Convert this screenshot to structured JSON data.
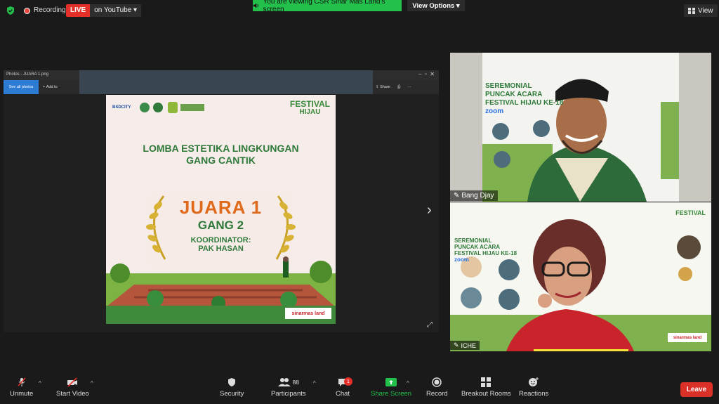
{
  "topbar": {
    "recording": "Recording",
    "live": "LIVE",
    "on_youtube": "on YouTube",
    "share_banner": "You are viewing CSR Sinar Mas Land's screen",
    "view_options": "View Options",
    "view": "View"
  },
  "photos_app": {
    "title": "Photos - JUARA 1.png",
    "see_all": "See all photos",
    "add_to": "Add to",
    "share": "Share"
  },
  "poster": {
    "bsd": "BSDCITY",
    "festival": "FESTIVAL",
    "hijau": "HIJAU",
    "title_line1": "LOMBA ESTETIKA LINGKUNGAN",
    "title_line2": "GANG CANTIK",
    "juara": "JUARA 1",
    "gang": "GANG 2",
    "koordinator": "KOORDINATOR:",
    "pak_hasan": "PAK HASAN",
    "sinarmas": "sinarmas land"
  },
  "tile1_poster": {
    "line1": "SEREMONIAL",
    "line2": "PUNCAK ACARA",
    "line3": "FESTIVAL HIJAU KE-18",
    "zoom": "zoom"
  },
  "tile2_poster": {
    "line1": "SEREMONIAL",
    "line2": "PUNCAK ACARA",
    "line3": "FESTIVAL HIJAU KE-18",
    "zoom": "zoom",
    "festival": "FESTIVAL",
    "sinarmas": "sinarmas land"
  },
  "participants": [
    {
      "name": "Bang Djay"
    },
    {
      "name": "ICHE"
    }
  ],
  "toolbar": {
    "unmute": "Unmute",
    "start_video": "Start Video",
    "security": "Security",
    "participants": "Participants",
    "participants_count": "88",
    "chat": "Chat",
    "chat_badge": "1",
    "share_screen": "Share Screen",
    "record": "Record",
    "breakout": "Breakout Rooms",
    "reactions": "Reactions",
    "leave": "Leave"
  },
  "colors": {
    "share_green": "#23c04b",
    "live_red": "#e5302a",
    "leave_red": "#d93028",
    "poster_green": "#2f7a3a",
    "poster_orange": "#e06a1c",
    "speaker_yellow": "#f7e13a"
  }
}
